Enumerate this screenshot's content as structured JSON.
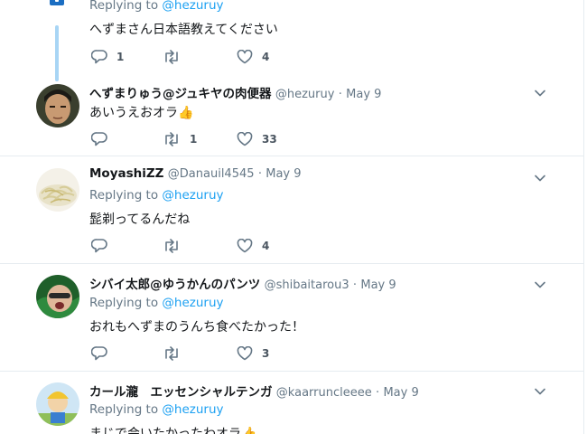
{
  "tweets": [
    {
      "reply_prefix": "Replying to",
      "reply_to": "@hezuruy",
      "text": "へずまさん日本語教えてください",
      "reply_count": "1",
      "retweet_count": "",
      "like_count": "4"
    },
    {
      "name": "へずまりゅう@ジュキヤの肉便器",
      "handle": "@hezuruy",
      "dot": "·",
      "date": "May 9",
      "text": "あいうえおオラ👍",
      "reply_count": "",
      "retweet_count": "1",
      "like_count": "33"
    },
    {
      "name": "MoyashiZZ",
      "handle": "@Danauil4545",
      "dot": "·",
      "date": "May 9",
      "reply_prefix": "Replying to",
      "reply_to": "@hezuruy",
      "text": "髭剃ってるんだね",
      "reply_count": "",
      "retweet_count": "",
      "like_count": "4"
    },
    {
      "name": "シバイ太郎@ゆうかんのパンツ",
      "handle": "@shibaitarou3",
      "dot": "·",
      "date": "May 9",
      "reply_prefix": "Replying to",
      "reply_to": "@hezuruy",
      "text": "おれもへずまのうんち食べたかった！",
      "reply_count": "",
      "retweet_count": "",
      "like_count": "3"
    },
    {
      "name": "カール瀧　エッセンシャルテンガ",
      "handle": "@kaarruncleeee",
      "dot": "·",
      "date": "May 9",
      "reply_prefix": "Replying to",
      "reply_to": "@hezuruy",
      "text": "まじで会いたかったわオラ👍",
      "reply_count": "",
      "retweet_count": "",
      "like_count": ""
    }
  ]
}
